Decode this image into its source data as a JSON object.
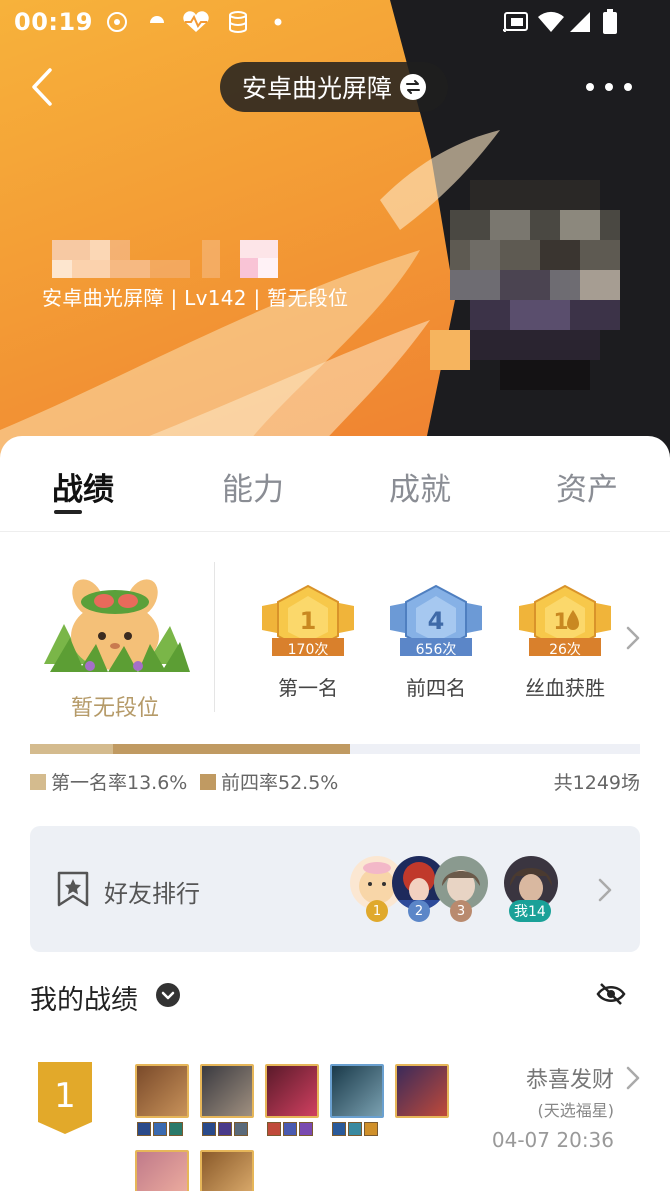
{
  "status_bar": {
    "time": "00:19",
    "left_icons": [
      "flower-icon",
      "umbrella-icon",
      "heart-pulse-icon",
      "database-icon",
      "dot-icon"
    ],
    "right_icons": [
      "cast-icon",
      "wifi-icon",
      "signal-icon",
      "battery-icon"
    ]
  },
  "header": {
    "title": "安卓曲光屏障",
    "switch_icon": "switch-arrows-icon",
    "back_icon": "back-chevron-icon",
    "more_icon": "more-dots-icon"
  },
  "profile": {
    "info": "安卓曲光屏障 | Lv142 | 暂无段位"
  },
  "tabs": [
    {
      "label": "战绩",
      "active": true
    },
    {
      "label": "能力",
      "active": false
    },
    {
      "label": "成就",
      "active": false
    },
    {
      "label": "资产",
      "active": false
    }
  ],
  "rank": {
    "label": "暂无段位"
  },
  "medals": [
    {
      "number": "1",
      "count": "170次",
      "label": "第一名",
      "color": "#f0b43a"
    },
    {
      "number": "4",
      "count": "656次",
      "label": "前四名",
      "color": "#6c9ad6"
    },
    {
      "number": "1",
      "count": "26次",
      "label": "丝血获胜",
      "color": "#f0b43a"
    }
  ],
  "stats": {
    "first_rate": "第一名率13.6%",
    "top4_rate": "前四率52.5%",
    "total": "共1249场",
    "first_fraction": 0.136,
    "top4_fraction": 0.525,
    "first_color": "#d4bb8e",
    "top4_color": "#c09a62"
  },
  "friends": {
    "label": "好友排行",
    "ranks": [
      "1",
      "2",
      "3"
    ],
    "me": "我14",
    "badge_colors": [
      "#e0a92c",
      "#5b86c8",
      "#b98a6e",
      "#1aa198"
    ]
  },
  "my_record": {
    "title": "我的战绩"
  },
  "match": {
    "place": "1",
    "title": "恭喜发财",
    "subtitle": "(天选福星)",
    "time": "04-07 20:36"
  }
}
